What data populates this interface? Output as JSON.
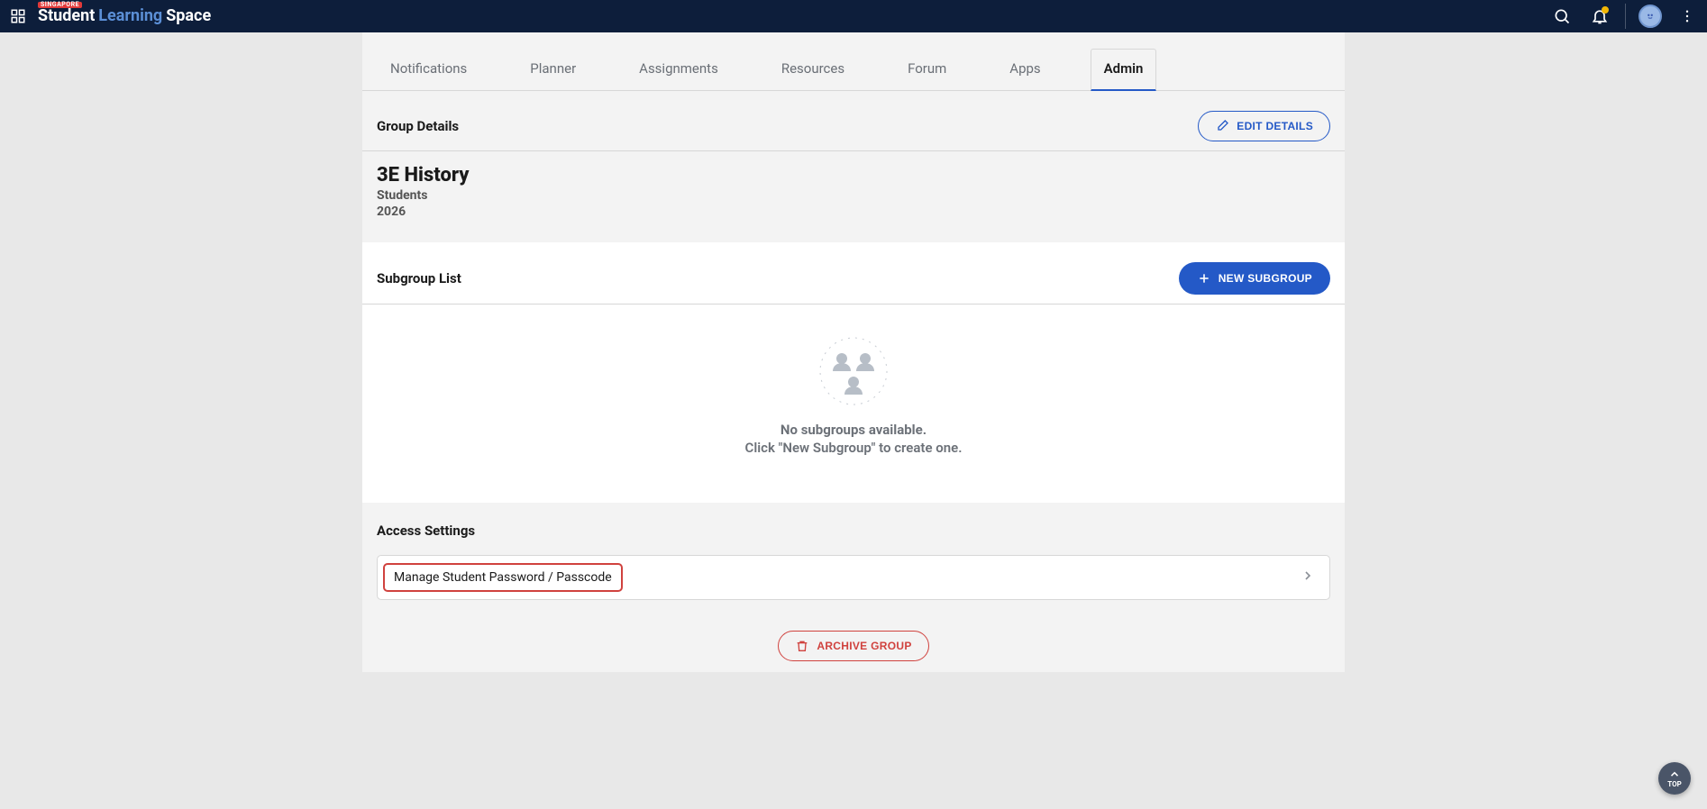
{
  "brand": {
    "tag": "SINGAPORE",
    "p1": "Student",
    "p2": "Learning",
    "p3": "Space"
  },
  "tabs": {
    "t0": "Notifications",
    "t1": "Planner",
    "t2": "Assignments",
    "t3": "Resources",
    "t4": "Forum",
    "t5": "Apps",
    "t6": "Admin"
  },
  "group_details": {
    "section_title": "Group Details",
    "edit_btn": "EDIT DETAILS",
    "name": "3E History",
    "subtitle": "Students",
    "year": "2026"
  },
  "subgroup": {
    "section_title": "Subgroup List",
    "new_btn": "NEW SUBGROUP",
    "empty_line1": "No subgroups available.",
    "empty_line2": "Click \"New Subgroup\" to create one."
  },
  "access": {
    "section_title": "Access Settings",
    "row_label": "Manage Student Password / Passcode"
  },
  "archive_btn": "ARCHIVE GROUP",
  "to_top": "TOP"
}
